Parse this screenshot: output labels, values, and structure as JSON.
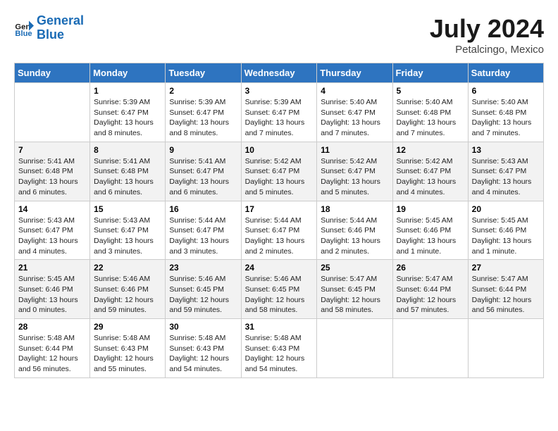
{
  "app": {
    "name": "GeneralBlue",
    "logo_text_1": "General",
    "logo_text_2": "Blue"
  },
  "calendar": {
    "month": "July 2024",
    "location": "Petalcingo, Mexico",
    "days_of_week": [
      "Sunday",
      "Monday",
      "Tuesday",
      "Wednesday",
      "Thursday",
      "Friday",
      "Saturday"
    ],
    "weeks": [
      [
        {
          "day": "",
          "info": ""
        },
        {
          "day": "1",
          "info": "Sunrise: 5:39 AM\nSunset: 6:47 PM\nDaylight: 13 hours\nand 8 minutes."
        },
        {
          "day": "2",
          "info": "Sunrise: 5:39 AM\nSunset: 6:47 PM\nDaylight: 13 hours\nand 8 minutes."
        },
        {
          "day": "3",
          "info": "Sunrise: 5:39 AM\nSunset: 6:47 PM\nDaylight: 13 hours\nand 7 minutes."
        },
        {
          "day": "4",
          "info": "Sunrise: 5:40 AM\nSunset: 6:47 PM\nDaylight: 13 hours\nand 7 minutes."
        },
        {
          "day": "5",
          "info": "Sunrise: 5:40 AM\nSunset: 6:48 PM\nDaylight: 13 hours\nand 7 minutes."
        },
        {
          "day": "6",
          "info": "Sunrise: 5:40 AM\nSunset: 6:48 PM\nDaylight: 13 hours\nand 7 minutes."
        }
      ],
      [
        {
          "day": "7",
          "info": "Sunrise: 5:41 AM\nSunset: 6:48 PM\nDaylight: 13 hours\nand 6 minutes."
        },
        {
          "day": "8",
          "info": "Sunrise: 5:41 AM\nSunset: 6:48 PM\nDaylight: 13 hours\nand 6 minutes."
        },
        {
          "day": "9",
          "info": "Sunrise: 5:41 AM\nSunset: 6:47 PM\nDaylight: 13 hours\nand 6 minutes."
        },
        {
          "day": "10",
          "info": "Sunrise: 5:42 AM\nSunset: 6:47 PM\nDaylight: 13 hours\nand 5 minutes."
        },
        {
          "day": "11",
          "info": "Sunrise: 5:42 AM\nSunset: 6:47 PM\nDaylight: 13 hours\nand 5 minutes."
        },
        {
          "day": "12",
          "info": "Sunrise: 5:42 AM\nSunset: 6:47 PM\nDaylight: 13 hours\nand 4 minutes."
        },
        {
          "day": "13",
          "info": "Sunrise: 5:43 AM\nSunset: 6:47 PM\nDaylight: 13 hours\nand 4 minutes."
        }
      ],
      [
        {
          "day": "14",
          "info": "Sunrise: 5:43 AM\nSunset: 6:47 PM\nDaylight: 13 hours\nand 4 minutes."
        },
        {
          "day": "15",
          "info": "Sunrise: 5:43 AM\nSunset: 6:47 PM\nDaylight: 13 hours\nand 3 minutes."
        },
        {
          "day": "16",
          "info": "Sunrise: 5:44 AM\nSunset: 6:47 PM\nDaylight: 13 hours\nand 3 minutes."
        },
        {
          "day": "17",
          "info": "Sunrise: 5:44 AM\nSunset: 6:47 PM\nDaylight: 13 hours\nand 2 minutes."
        },
        {
          "day": "18",
          "info": "Sunrise: 5:44 AM\nSunset: 6:46 PM\nDaylight: 13 hours\nand 2 minutes."
        },
        {
          "day": "19",
          "info": "Sunrise: 5:45 AM\nSunset: 6:46 PM\nDaylight: 13 hours\nand 1 minute."
        },
        {
          "day": "20",
          "info": "Sunrise: 5:45 AM\nSunset: 6:46 PM\nDaylight: 13 hours\nand 1 minute."
        }
      ],
      [
        {
          "day": "21",
          "info": "Sunrise: 5:45 AM\nSunset: 6:46 PM\nDaylight: 13 hours\nand 0 minutes."
        },
        {
          "day": "22",
          "info": "Sunrise: 5:46 AM\nSunset: 6:46 PM\nDaylight: 12 hours\nand 59 minutes."
        },
        {
          "day": "23",
          "info": "Sunrise: 5:46 AM\nSunset: 6:45 PM\nDaylight: 12 hours\nand 59 minutes."
        },
        {
          "day": "24",
          "info": "Sunrise: 5:46 AM\nSunset: 6:45 PM\nDaylight: 12 hours\nand 58 minutes."
        },
        {
          "day": "25",
          "info": "Sunrise: 5:47 AM\nSunset: 6:45 PM\nDaylight: 12 hours\nand 58 minutes."
        },
        {
          "day": "26",
          "info": "Sunrise: 5:47 AM\nSunset: 6:44 PM\nDaylight: 12 hours\nand 57 minutes."
        },
        {
          "day": "27",
          "info": "Sunrise: 5:47 AM\nSunset: 6:44 PM\nDaylight: 12 hours\nand 56 minutes."
        }
      ],
      [
        {
          "day": "28",
          "info": "Sunrise: 5:48 AM\nSunset: 6:44 PM\nDaylight: 12 hours\nand 56 minutes."
        },
        {
          "day": "29",
          "info": "Sunrise: 5:48 AM\nSunset: 6:43 PM\nDaylight: 12 hours\nand 55 minutes."
        },
        {
          "day": "30",
          "info": "Sunrise: 5:48 AM\nSunset: 6:43 PM\nDaylight: 12 hours\nand 54 minutes."
        },
        {
          "day": "31",
          "info": "Sunrise: 5:48 AM\nSunset: 6:43 PM\nDaylight: 12 hours\nand 54 minutes."
        },
        {
          "day": "",
          "info": ""
        },
        {
          "day": "",
          "info": ""
        },
        {
          "day": "",
          "info": ""
        }
      ]
    ]
  }
}
